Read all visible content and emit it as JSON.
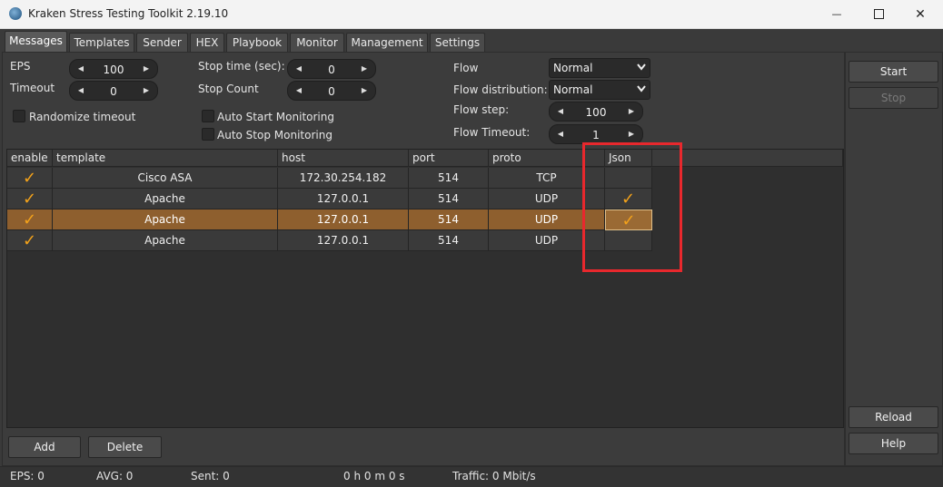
{
  "window": {
    "title": "Kraken Stress Testing Toolkit 2.19.10",
    "minimize": "—",
    "close": "✕"
  },
  "tabs": [
    "Messages",
    "Templates",
    "Sender",
    "HEX",
    "Playbook",
    "Monitor",
    "Management",
    "Settings"
  ],
  "settings": {
    "eps_label": "EPS",
    "eps_value": "100",
    "timeout_label": "Timeout",
    "timeout_value": "0",
    "randomize_label": "Randomize timeout",
    "stop_time_label": "Stop time (sec):",
    "stop_time_value": "0",
    "stop_count_label": "Stop Count",
    "stop_count_value": "0",
    "auto_start_label": "Auto Start Monitoring",
    "auto_stop_label": "Auto Stop Monitoring",
    "flow_label": "Flow",
    "flow_value": "Normal",
    "flow_dist_label": "Flow distribution:",
    "flow_dist_value": "Normal",
    "flow_step_label": "Flow step:",
    "flow_step_value": "100",
    "flow_timeout_label": "Flow Timeout:",
    "flow_timeout_value": "1"
  },
  "table": {
    "columns": [
      "enable",
      "template",
      "host",
      "port",
      "proto",
      "Json"
    ],
    "rows": [
      {
        "enable": "✓",
        "template": "Cisco ASA",
        "host": "172.30.254.182",
        "port": "514",
        "proto": "TCP",
        "json": ""
      },
      {
        "enable": "✓",
        "template": "Apache",
        "host": "127.0.0.1",
        "port": "514",
        "proto": "UDP",
        "json": "✓"
      },
      {
        "enable": "✓",
        "template": "Apache",
        "host": "127.0.0.1",
        "port": "514",
        "proto": "UDP",
        "json": "✓"
      },
      {
        "enable": "✓",
        "template": "Apache",
        "host": "127.0.0.1",
        "port": "514",
        "proto": "UDP",
        "json": ""
      }
    ],
    "selected_row": 2
  },
  "buttons": {
    "add": "Add",
    "delete": "Delete",
    "start": "Start",
    "stop": "Stop",
    "reload": "Reload",
    "help": "Help"
  },
  "status": {
    "eps": "EPS: 0",
    "avg": "AVG: 0",
    "sent": "Sent: 0",
    "time": "0 h 0 m 0 s",
    "traffic": "Traffic: 0 Mbit/s"
  },
  "colors": {
    "accent": "#f3a21a",
    "selected_row": "#8e5f2e",
    "highlight_box": "#e8282d"
  }
}
